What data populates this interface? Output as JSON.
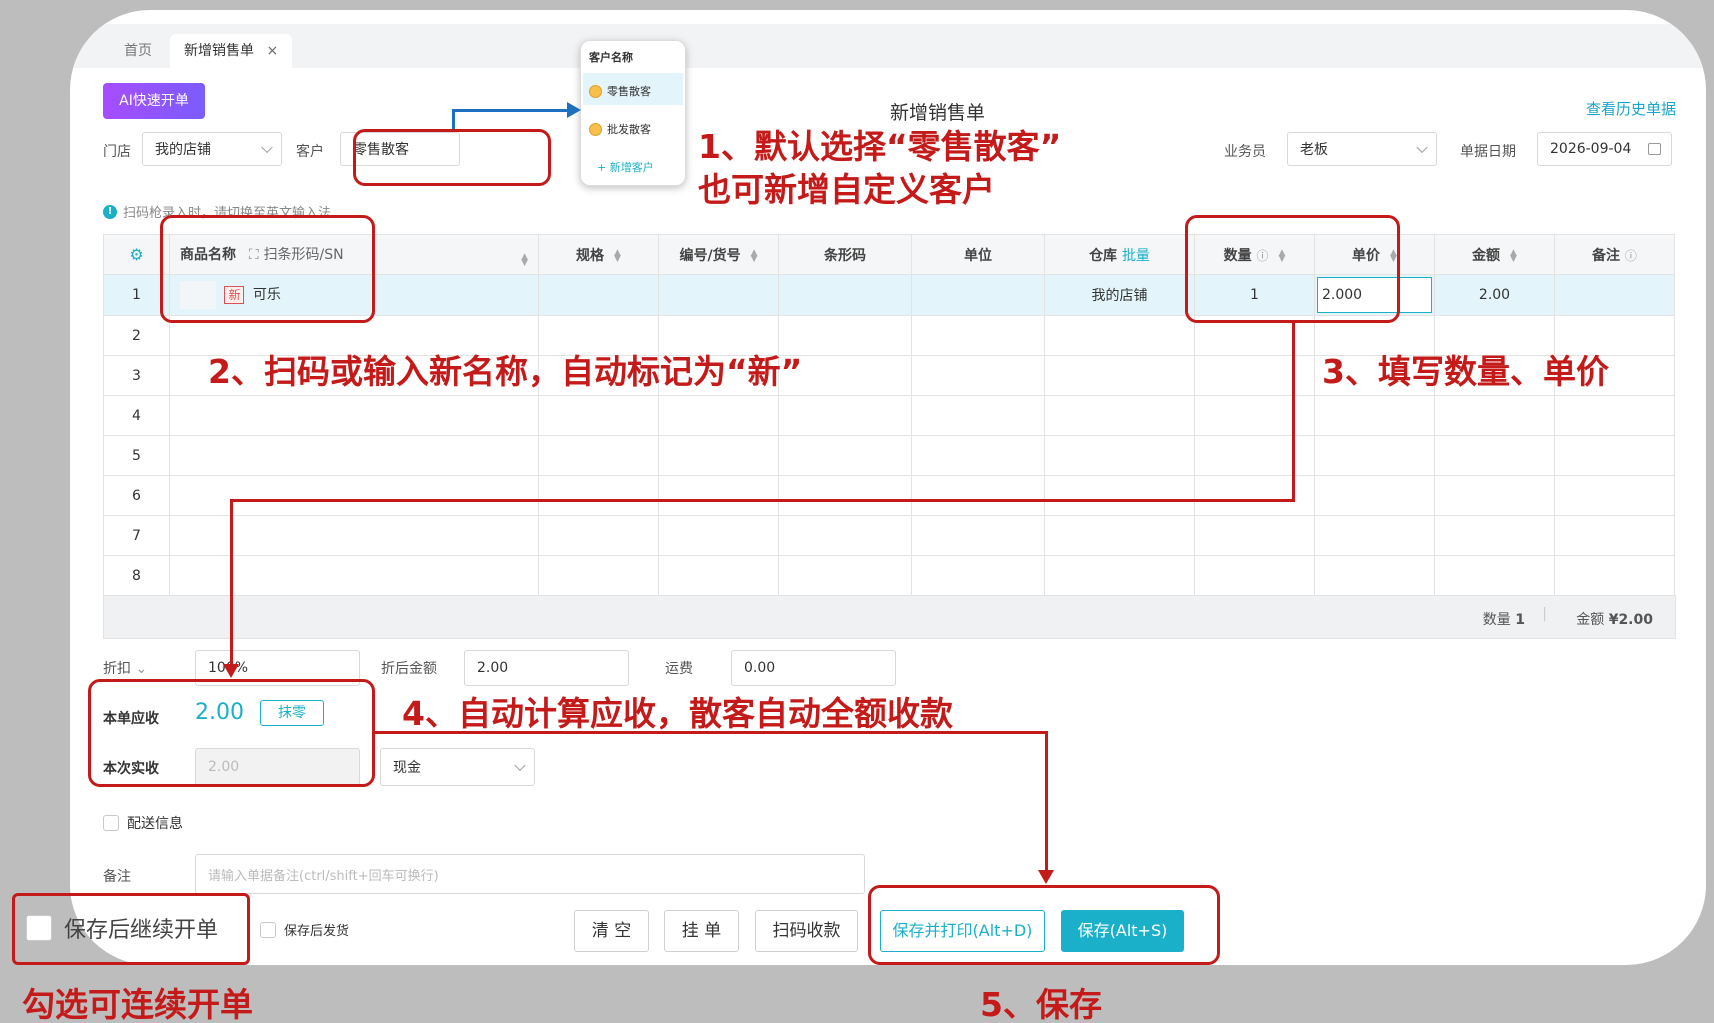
{
  "tabs": [
    {
      "label": "首页"
    },
    {
      "label": "新增销售单",
      "close": "×"
    }
  ],
  "header": {
    "ai_button": "AI快速开单",
    "title": "新增销售单",
    "history_link": "查看历史单据"
  },
  "form": {
    "store_label": "门店",
    "store_value": "我的店铺",
    "customer_label": "客户",
    "customer_value": "零售散客",
    "salesperson_label": "业务员",
    "salesperson_value": "老板",
    "date_label": "单据日期",
    "date_value": "2026-09-04"
  },
  "customer_popup": {
    "header": "客户名称",
    "options": [
      "零售散客",
      "批发散客"
    ],
    "add_label": "+ 新增客户"
  },
  "hint": "扫码枪录入时，请切换至英文输入法",
  "table": {
    "columns": {
      "name": "商品名称",
      "scan": "扫条形码/SN",
      "spec": "规格",
      "code": "编号/货号",
      "barcode": "条形码",
      "unit": "单位",
      "warehouse": "仓库",
      "batch": "批量",
      "qty": "数量",
      "price": "单价",
      "amount": "金额",
      "note": "备注"
    },
    "rows": [
      {
        "no": "1",
        "badge": "新",
        "name": "可乐",
        "warehouse": "我的店铺",
        "qty": "1",
        "price": "2.000",
        "amount": "2.00"
      },
      {
        "no": "2"
      },
      {
        "no": "3"
      },
      {
        "no": "4"
      },
      {
        "no": "5"
      },
      {
        "no": "6"
      },
      {
        "no": "7"
      },
      {
        "no": "8"
      }
    ],
    "summary": {
      "qty_label": "数量",
      "qty_value": "1",
      "amount_label": "金额",
      "amount_value": "¥2.00"
    }
  },
  "footer": {
    "discount_label": "折扣",
    "discount_value": "100%",
    "after_discount_label": "折后金额",
    "after_discount_value": "2.00",
    "shipping_label": "运费",
    "shipping_value": "0.00",
    "receivable_label": "本单应收",
    "receivable_value": "2.00",
    "round_button": "抹零",
    "received_label": "本次实收",
    "received_value": "2.00",
    "payment_method": "现金",
    "delivery_label": "配送信息",
    "remark_label": "备注",
    "remark_placeholder": "请输入单据备注(ctrl/shift+回车可换行)",
    "continue_label": "保存后继续开单",
    "ship_after_save_label": "保存后发货",
    "clear_button": "清 空",
    "hold_button": "挂 单",
    "scan_pay_button": "扫码收款",
    "save_print_button": "保存并打印(Alt+D)",
    "save_button": "保存(Alt+S)"
  },
  "annotations": {
    "step1_line1": "1、默认选择“零售散客”",
    "step1_line2": "也可新增自定义客户",
    "step2": "2、扫码或输入新名称，自动标记为“新”",
    "step3": "3、填写数量、单价",
    "step4": "4、自动计算应收，散客自动全额收款",
    "step5": "5、保存",
    "continue_tip": "勾选可连续开单"
  },
  "colors": {
    "accent": "#1ab0c9",
    "annotation": "#c41a1a",
    "ai_gradient": "#a64dff"
  }
}
